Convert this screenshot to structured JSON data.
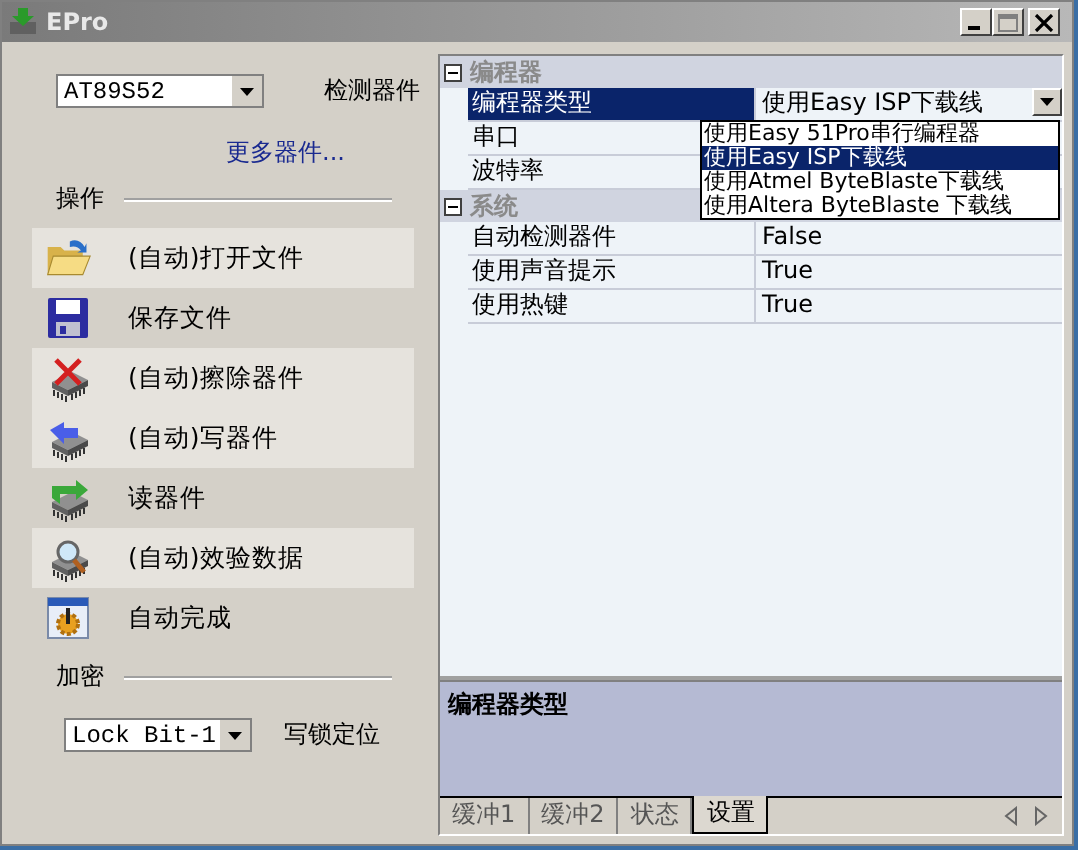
{
  "window": {
    "title": "EPro"
  },
  "device": {
    "value": "AT89S52",
    "detect_label": "检测器件",
    "more_link": "更多器件..."
  },
  "operations": {
    "label": "操作",
    "items": [
      {
        "label": "(自动)打开文件",
        "kind": "folder",
        "shaded": true
      },
      {
        "label": "保存文件",
        "kind": "floppy",
        "shaded": false
      },
      {
        "label": "(自动)擦除器件",
        "kind": "erase",
        "shaded": true
      },
      {
        "label": "(自动)写器件",
        "kind": "write",
        "shaded": true
      },
      {
        "label": "读器件",
        "kind": "read",
        "shaded": false
      },
      {
        "label": "(自动)效验数据",
        "kind": "verify",
        "shaded": true
      },
      {
        "label": "自动完成",
        "kind": "auto",
        "shaded": false
      }
    ]
  },
  "encryption": {
    "label": "加密",
    "value": "Lock Bit-1",
    "button": "写锁定位"
  },
  "properties": {
    "categories": [
      {
        "name": "编程器",
        "expanded": true,
        "rows": [
          {
            "name": "编程器类型",
            "value": "使用Easy ISP下载线",
            "selected": true
          },
          {
            "name": "串口",
            "selected": false
          },
          {
            "name": "波特率",
            "selected": false
          }
        ]
      },
      {
        "name": "系统",
        "expanded": true,
        "rows": [
          {
            "name": "自动检测器件",
            "value": "False",
            "selected": false
          },
          {
            "name": "使用声音提示",
            "value": "True",
            "selected": false
          },
          {
            "name": "使用热键",
            "value": "True",
            "selected": false
          }
        ]
      }
    ]
  },
  "dropdown_list": {
    "items": [
      {
        "label": "使用Easy 51Pro串行编程器",
        "selected": false
      },
      {
        "label": "使用Easy ISP下载线",
        "selected": true
      },
      {
        "label": "使用Atmel ByteBlaste下载线",
        "selected": false
      },
      {
        "label": "使用Altera ByteBlaste 下载线",
        "selected": false
      }
    ]
  },
  "description": {
    "title": "编程器类型"
  },
  "tabs": [
    {
      "label": "缓冲1",
      "selected": false
    },
    {
      "label": "缓冲2",
      "selected": false
    },
    {
      "label": "状态",
      "selected": false
    },
    {
      "label": "设置",
      "selected": true
    }
  ]
}
